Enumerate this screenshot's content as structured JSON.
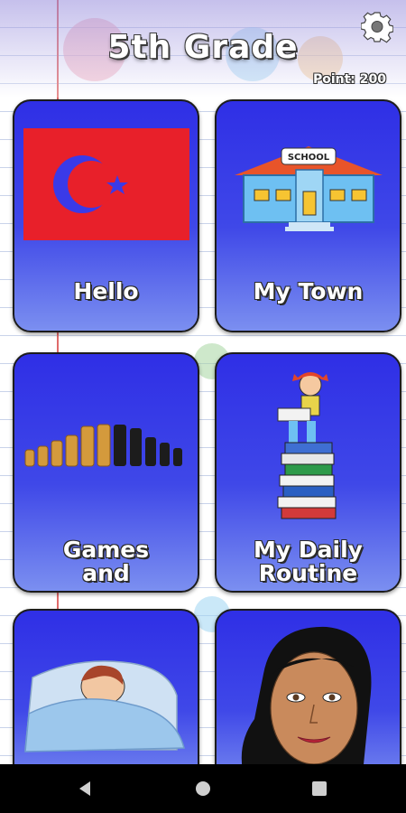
{
  "header": {
    "title": "5th  Grade",
    "points_label": "Point: 200"
  },
  "cards": [
    {
      "label": "Hello",
      "icon": "turkish-flag-icon"
    },
    {
      "label": "My Town",
      "icon": "school-building-icon"
    },
    {
      "label_line1": "Games",
      "label_line2": "and",
      "icon": "chess-pieces-icon"
    },
    {
      "label_line1": "My Daily",
      "label_line2": "Routine",
      "icon": "girl-reading-books-icon"
    },
    {
      "icon": "sick-child-in-bed-icon"
    },
    {
      "icon": "woman-face-icon"
    }
  ],
  "navigation": {
    "back": "back-triangle-icon",
    "home": "home-circle-icon",
    "recents": "recents-square-icon"
  },
  "colors": {
    "card_top": "#2f2fe6",
    "card_bottom": "#7b8ff0",
    "flag_red": "#e8202a"
  }
}
